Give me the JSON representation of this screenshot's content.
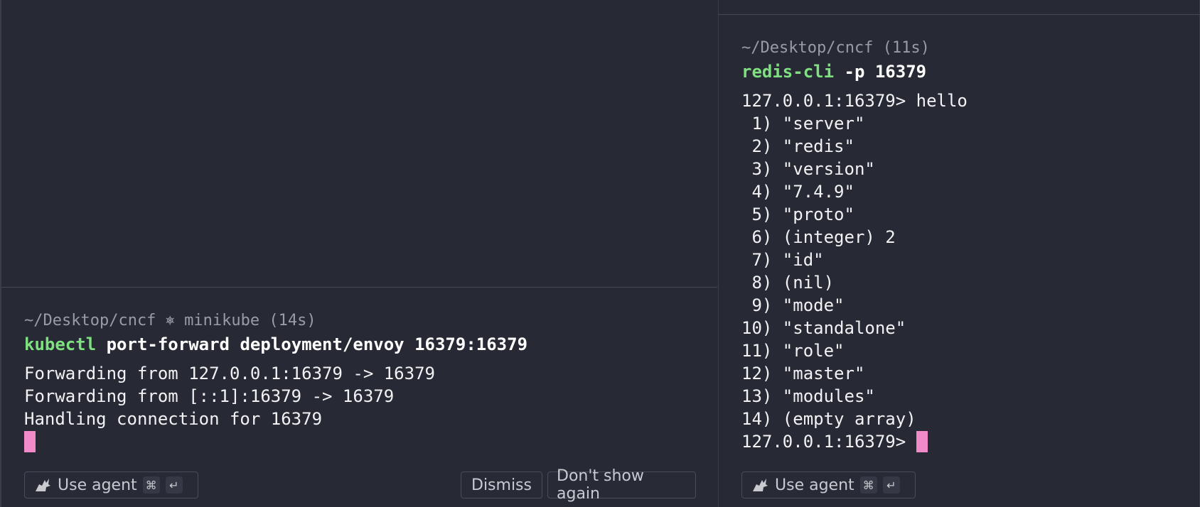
{
  "left": {
    "prompt_meta": "~/Desktop/cncf ⎈ minikube (14s)",
    "command_program": "kubectl",
    "command_args": " port-forward deployment/envoy 16379:16379",
    "output": [
      "Forwarding from 127.0.0.1:16379 -> 16379",
      "Forwarding from [::1]:16379 -> 16379",
      "Handling connection for 16379"
    ],
    "use_agent_label": "Use agent",
    "shortcut_cmd": "⌘",
    "shortcut_enter": "↵",
    "dismiss_label": "Dismiss",
    "dont_show_label": "Don't show again"
  },
  "right": {
    "prompt_meta": "~/Desktop/cncf (11s)",
    "command_program": "redis-cli",
    "command_args": " -p 16379",
    "output": [
      "127.0.0.1:16379> hello",
      " 1) \"server\"",
      " 2) \"redis\"",
      " 3) \"version\"",
      " 4) \"7.4.9\"",
      " 5) \"proto\"",
      " 6) (integer) 2",
      " 7) \"id\"",
      " 8) (nil)",
      " 9) \"mode\"",
      "10) \"standalone\"",
      "11) \"role\"",
      "12) \"master\"",
      "13) \"modules\"",
      "14) (empty array)"
    ],
    "current_prompt": "127.0.0.1:16379> ",
    "use_agent_label": "Use agent",
    "shortcut_cmd": "⌘",
    "shortcut_enter": "↵"
  },
  "colors": {
    "background": "#272a35",
    "program": "#7ee07e",
    "cursor": "#f08ac8",
    "meta": "#9a9ca4"
  }
}
